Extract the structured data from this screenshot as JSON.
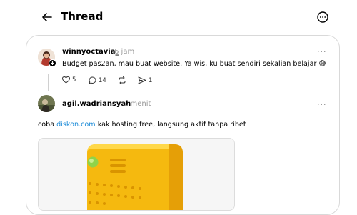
{
  "header": {
    "title": "Thread",
    "back_icon": "arrow-left-icon",
    "more_icon": "more-circle-icon"
  },
  "posts": [
    {
      "username": "winnyoctavia_",
      "time": "6 jam",
      "text": "Budget pas2an, mau buat website. Ya wis, ku buat sendiri sekalian belajar 😅",
      "likes": "5",
      "comments": "14",
      "shares": "1",
      "more_label": "···"
    },
    {
      "username": "agil.wadriansyah",
      "time": "1 menit",
      "text_before": "coba ",
      "link_text": "diskon.com",
      "text_after": " kak hosting free, langsung aktif tanpa ribet",
      "more_label": "···"
    }
  ],
  "colors": {
    "link": "#1d8cd8",
    "muted": "#999999",
    "server_yellow": "#f7c21a",
    "server_light": "#8fd34a"
  }
}
